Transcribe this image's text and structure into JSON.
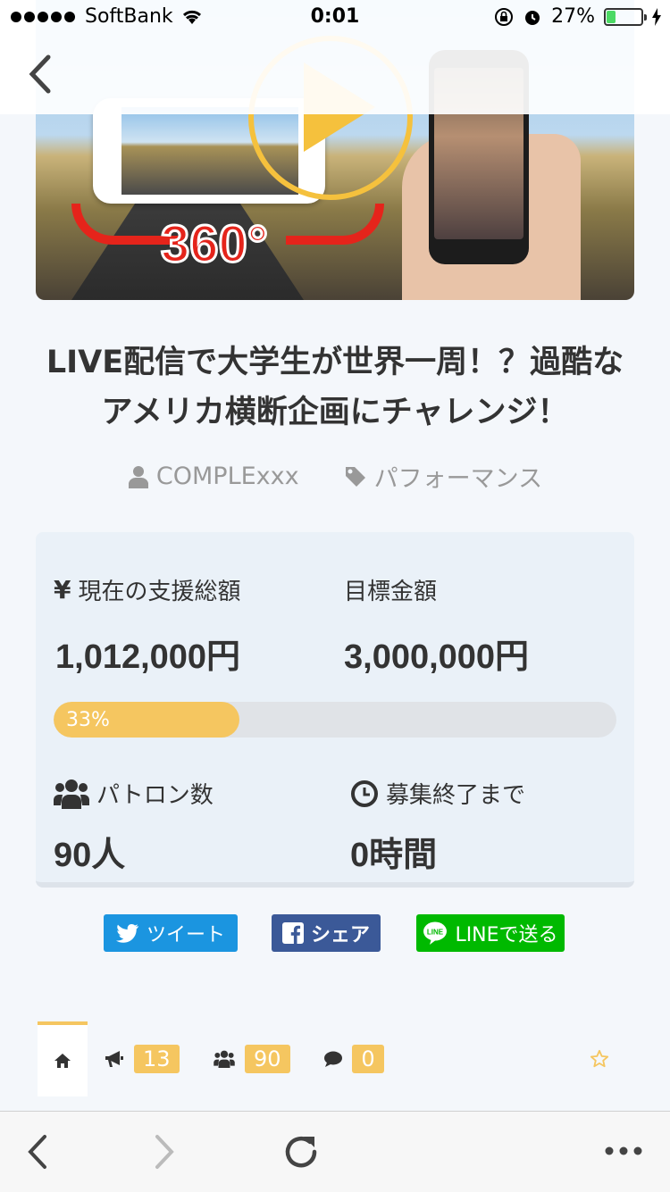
{
  "status_bar": {
    "carrier": "SoftBank",
    "time": "0:01",
    "battery_percent": "27%",
    "battery_level": 0.27
  },
  "header": {
    "back_icon": "chevron-left-icon"
  },
  "hero": {
    "overlay_text": "360°"
  },
  "project": {
    "title_line1": "LIVE配信で大学生が世界一周！？過酷な",
    "title_line2": "アメリカ横断企画にチャレンジ！",
    "author": "COMPLExxx",
    "category": "パフォーマンス"
  },
  "stats": {
    "raised_label": "現在の支援総額",
    "raised_value": "1,012,000円",
    "goal_label": "目標金額",
    "goal_value": "3,000,000円",
    "progress_text": "33%",
    "progress_fraction": 0.33,
    "patrons_label": "パトロン数",
    "patrons_value": "90人",
    "remaining_label": "募集終了まで",
    "remaining_value": "0時間"
  },
  "share": {
    "tweet": "ツイート",
    "facebook": "シェア",
    "line": "LINEで送る"
  },
  "tabs": {
    "updates_count": "13",
    "patrons_count": "90",
    "comments_count": "0"
  },
  "colors": {
    "accent": "#f5c660",
    "twitter": "#1b95e0",
    "facebook": "#3b5998",
    "line": "#00b900"
  }
}
